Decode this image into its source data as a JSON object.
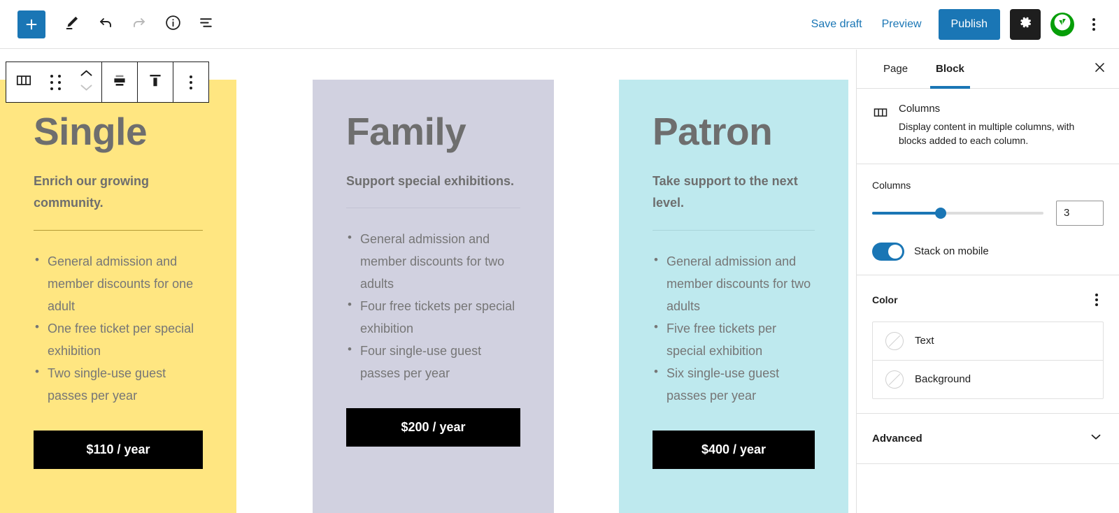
{
  "topbar": {
    "add_icon": "plus-icon",
    "tools": [
      {
        "name": "edit-tool",
        "icon": "pencil-icon",
        "disabled": false
      },
      {
        "name": "undo",
        "icon": "undo-arrow-icon",
        "disabled": false
      },
      {
        "name": "redo",
        "icon": "redo-arrow-icon",
        "disabled": true
      },
      {
        "name": "details",
        "icon": "info-circle-icon",
        "disabled": false
      },
      {
        "name": "list-view",
        "icon": "list-view-icon",
        "disabled": false
      }
    ],
    "save_draft": "Save draft",
    "preview": "Preview",
    "publish": "Publish",
    "settings_icon": "gear-icon",
    "jetpack_icon": "jetpack-icon",
    "more_icon": "kebab-menu-icon"
  },
  "block_toolbar": {
    "block_type_icon": "columns-icon",
    "drag_icon": "drag-handle-icon",
    "move_up_icon": "chevron-up-icon",
    "move_down_icon": "chevron-down-icon",
    "align_icon": "align-center-icon",
    "vertical_align_icon": "vertical-align-top-icon",
    "options_icon": "kebab-menu-icon"
  },
  "content": {
    "columns": [
      {
        "name": "single",
        "title": "Single",
        "subtitle": "Enrich our growing community.",
        "background": "#ffe681",
        "rule_color": "#b39b35",
        "items": [
          "General admission and member discounts for one adult",
          "One free ticket per special exhibition",
          "Two single-use guest passes per year"
        ],
        "price": "$110 / year"
      },
      {
        "name": "family",
        "title": "Family",
        "subtitle": "Support special exhibitions.",
        "background": "#d1d1e0",
        "rule_color": "#c3c3d3",
        "items": [
          "General admission and member discounts for two adults",
          "Four free tickets per special exhibition",
          "Four single-use guest passes per year"
        ],
        "price": "$200 / year"
      },
      {
        "name": "patron",
        "title": "Patron",
        "subtitle": "Take support to the next level.",
        "background": "#bee9ee",
        "rule_color": "#a9d4da",
        "items": [
          "General admission and member discounts for two adults",
          "Five free tickets per special exhibition",
          "Six single-use guest passes per year"
        ],
        "price": "$400 / year"
      }
    ]
  },
  "sidebar": {
    "tabs": [
      {
        "label": "Page",
        "active": false
      },
      {
        "label": "Block",
        "active": true
      }
    ],
    "close_icon": "close-icon",
    "block": {
      "icon": "columns-icon",
      "name": "Columns",
      "description": "Display content in multiple columns, with blocks added to each column."
    },
    "columns_setting": {
      "label": "Columns",
      "value": "3",
      "slider_percent": 40
    },
    "stack_on_mobile": {
      "label": "Stack on mobile",
      "enabled": true
    },
    "color": {
      "title": "Color",
      "options_icon": "kebab-menu-icon",
      "rows": [
        {
          "label": "Text",
          "swatch": "none"
        },
        {
          "label": "Background",
          "swatch": "none"
        }
      ]
    },
    "advanced": {
      "label": "Advanced",
      "chevron_icon": "chevron-down-icon"
    }
  },
  "theme": {
    "accent": "#1a76b5",
    "jetpack_green": "#069e08",
    "button_black": "#000000",
    "text_gray": "#767676"
  }
}
